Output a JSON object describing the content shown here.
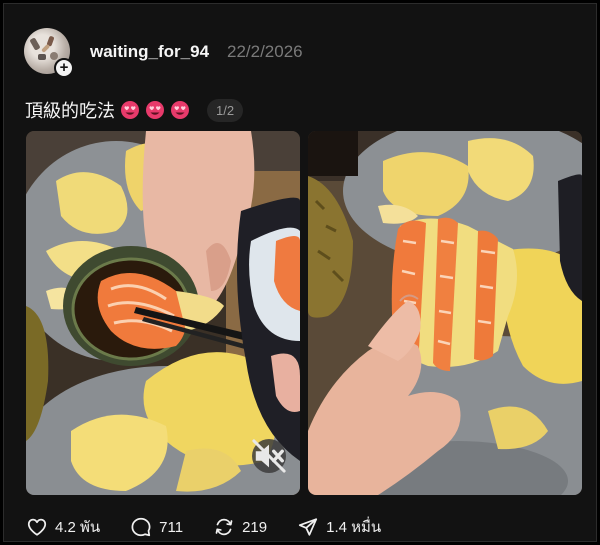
{
  "post": {
    "username": "waiting_for_94",
    "date": "22/2/2026",
    "caption": "頂級的吃法",
    "emoji_icons": [
      "smiling-face-with-heart-eyes-icon",
      "smiling-face-with-heart-eyes-icon",
      "smiling-face-with-heart-eyes-icon"
    ],
    "page_indicator": "1/2",
    "media": [
      {
        "type": "video",
        "muted": true
      },
      {
        "type": "image"
      }
    ]
  },
  "actions": {
    "likes": "4.2 พัน",
    "comments": "711",
    "reposts": "219",
    "shares": "1.4 หมื่น"
  },
  "colors": {
    "background": "#121212",
    "text": "#f3f3f3",
    "muted_text": "#7a7a7a",
    "durian_yellow": "#f2d65a",
    "salmon": "#f07a3c"
  }
}
